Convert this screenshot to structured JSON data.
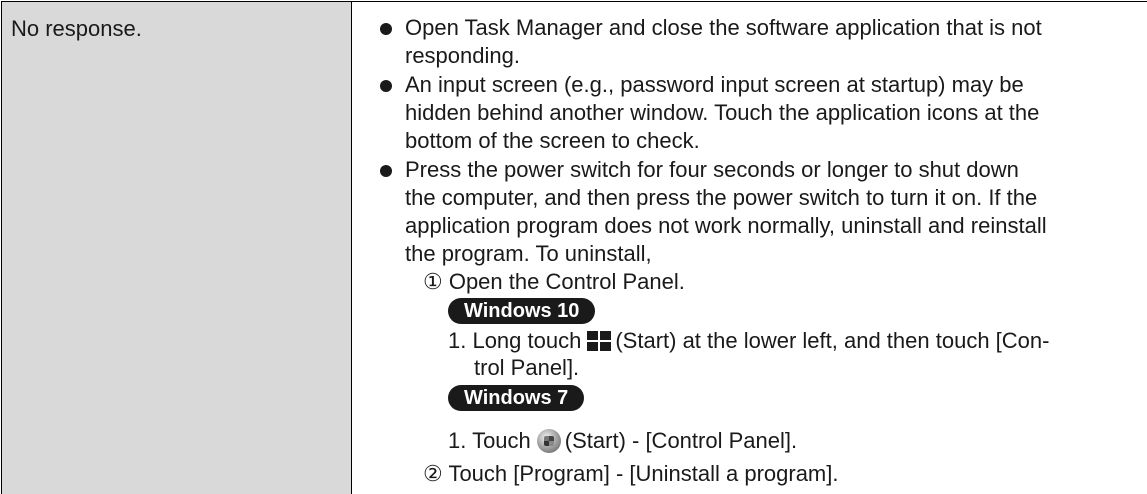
{
  "left_cell": {
    "text": "No response."
  },
  "right_cell": {
    "bullet1": {
      "line1": "Open Task Manager and close the software application that is not",
      "line2": "responding."
    },
    "bullet2": {
      "line1": "An input screen (e.g., password input screen at startup) may be",
      "line2": "hidden behind another window. Touch the application icons at the",
      "line3": "bottom of the screen to check."
    },
    "bullet3": {
      "line1": "Press the power switch for four seconds or longer to shut down",
      "line2": "the computer, and then press the power switch to turn it on. If the",
      "line3": "application program does not work normally, uninstall and reinstall",
      "line4": "the program. To uninstall,"
    },
    "step1": "① Open the Control Panel.",
    "win10": {
      "badge": "Windows 10",
      "line1_before": "1. Long touch",
      "line1_after": "(Start) at the lower left, and then touch [Con-",
      "line2": "trol Panel]."
    },
    "win7": {
      "badge": "Windows 7",
      "line1_before": "1. Touch",
      "line1_after": "(Start) - [Control Panel]."
    },
    "step2": "② Touch [Program] - [Uninstall a program]."
  },
  "icons": {
    "windows10": "windows-10-start-icon",
    "windows7": "windows-7-start-orb-icon"
  },
  "colors": {
    "left_cell_bg": "#d9d9d9",
    "badge_bg": "#1a1a1a",
    "text": "#1a1a1a"
  }
}
